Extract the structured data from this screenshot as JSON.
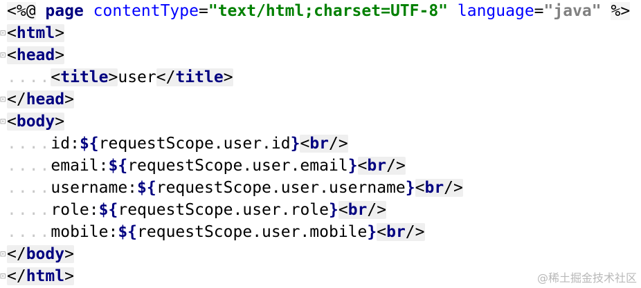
{
  "code": {
    "line1": {
      "open": "<%@",
      "kw": "page",
      "attr1": "contentType",
      "eq1": "=",
      "val1": "\"text/html;charset=UTF-8\"",
      "attr2": "language",
      "eq2": "=",
      "val2": "\"java\"",
      "close": "%>"
    },
    "line2": {
      "lt": "<",
      "tag": "html",
      "gt": ">"
    },
    "line3": {
      "lt": "<",
      "tag": "head",
      "gt": ">"
    },
    "line4": {
      "indent": "....",
      "lt1": "<",
      "tag1": "title",
      "gt1": ">",
      "text": "user",
      "lt2": "</",
      "tag2": "title",
      "gt2": ">"
    },
    "line5": {
      "lt": "</",
      "tag": "head",
      "gt": ">"
    },
    "line6": {
      "lt": "<",
      "tag": "body",
      "gt": ">"
    },
    "fields": [
      {
        "indent": "....",
        "label": "id:",
        "open": "${",
        "expr": "requestScope.user.id",
        "close": "}",
        "br_lt": "<",
        "br": "br",
        "br_gt": "/>"
      },
      {
        "indent": "....",
        "label": "email:",
        "open": "${",
        "expr": "requestScope.user.email",
        "close": "}",
        "br_lt": "<",
        "br": "br",
        "br_gt": "/>"
      },
      {
        "indent": "....",
        "label": "username:",
        "open": "${",
        "expr": "requestScope.user.username",
        "close": "}",
        "br_lt": "<",
        "br": "br",
        "br_gt": "/>"
      },
      {
        "indent": "....",
        "label": "role:",
        "open": "${",
        "expr": "requestScope.user.role",
        "close": "}",
        "br_lt": "<",
        "br": "br",
        "br_gt": "/>"
      },
      {
        "indent": "....",
        "label": "mobile:",
        "open": "${",
        "expr": "requestScope.user.mobile",
        "close": "}",
        "br_lt": "<",
        "br": "br",
        "br_gt": "/>"
      }
    ],
    "line12": {
      "lt": "</",
      "tag": "body",
      "gt": ">"
    },
    "line13": {
      "lt": "</",
      "tag": "html",
      "gt": ">"
    }
  },
  "watermark": "@稀土掘金技术社区",
  "gutter_marker": "⊡"
}
